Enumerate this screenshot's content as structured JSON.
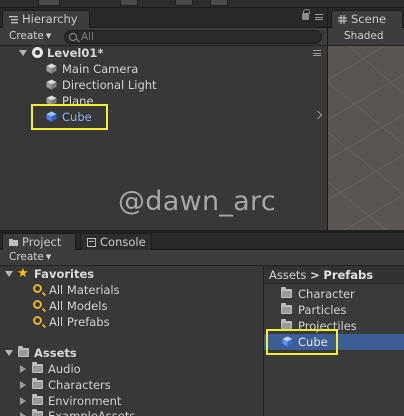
{
  "hierarchy": {
    "tab_label": "Hierarchy",
    "create_label": "Create",
    "search_placeholder": "All",
    "scene_name": "Level01*",
    "items": [
      {
        "label": "Main Camera"
      },
      {
        "label": "Directional Light"
      },
      {
        "label": "Plane"
      },
      {
        "label": "Cube"
      }
    ]
  },
  "scene": {
    "tab_label": "Scene",
    "shading_label": "Shaded"
  },
  "watermark": "@dawn_arc",
  "project": {
    "tabs": [
      {
        "label": "Project"
      },
      {
        "label": "Console"
      }
    ],
    "create_label": "Create",
    "favorites": {
      "label": "Favorites",
      "items": [
        {
          "label": "All Materials"
        },
        {
          "label": "All Models"
        },
        {
          "label": "All Prefabs"
        }
      ]
    },
    "assets": {
      "label": "Assets",
      "items": [
        {
          "label": "Audio"
        },
        {
          "label": "Characters"
        },
        {
          "label": "Environment"
        },
        {
          "label": "ExampleAssets"
        }
      ]
    },
    "breadcrumb": {
      "root": "Assets",
      "separator": ">",
      "current": "Prefabs"
    },
    "folder_contents": [
      {
        "label": "Character"
      },
      {
        "label": "Particles"
      },
      {
        "label": "Projectiles"
      },
      {
        "label": "Cube"
      }
    ]
  },
  "colors": {
    "highlight_box": "#f1f12f",
    "selection": "#3e5f96",
    "selected_text": "#8fb0ef",
    "favorite_icon": "#f0c419"
  }
}
